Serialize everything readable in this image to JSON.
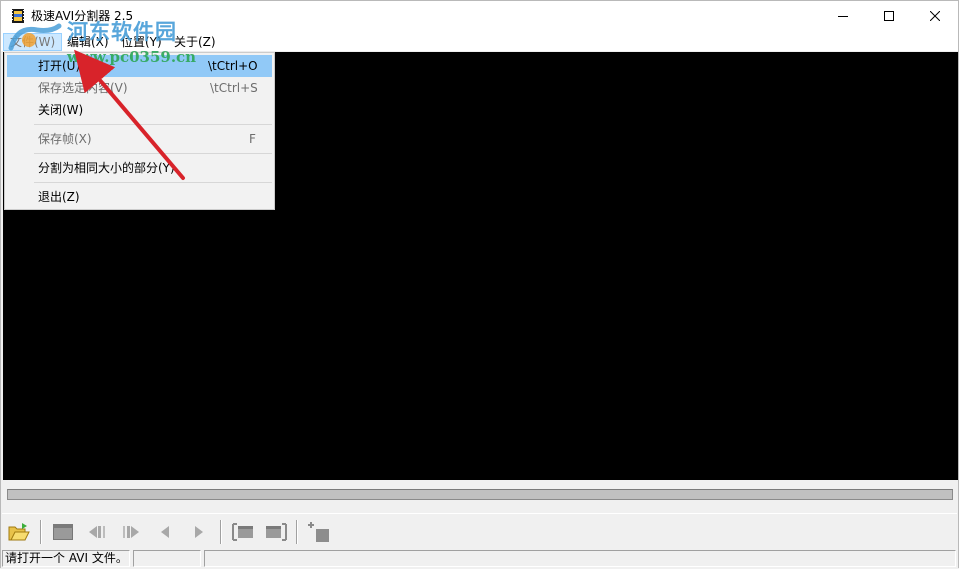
{
  "window": {
    "title": "极速AVI分割器 2.5",
    "icon": "film-app-icon"
  },
  "menubar": {
    "file": "文件(W)",
    "edit": "编辑(X)",
    "position": "位置(Y)",
    "about": "关于(Z)"
  },
  "file_menu": {
    "open": {
      "label": "打开(U)",
      "shortcut": "\\tCtrl+O"
    },
    "save_selection": {
      "label": "保存选定内容(V)",
      "shortcut": "\\tCtrl+S"
    },
    "close": {
      "label": "关闭(W)"
    },
    "save_frame": {
      "label": "保存帧(X)",
      "shortcut": "F"
    },
    "split_equal": {
      "label": "分割为相同大小的部分(Y)"
    },
    "exit": {
      "label": "退出(Z)"
    }
  },
  "statusbar": {
    "message": "请打开一个 AVI 文件。",
    "pane2": "",
    "pane3": ""
  },
  "watermark": {
    "title": "河东软件园",
    "url": "www.pc0359.cn"
  },
  "colors": {
    "video_bg": "#000000",
    "menu_highlight": "#91c9f7",
    "arrow": "#d8232a"
  }
}
